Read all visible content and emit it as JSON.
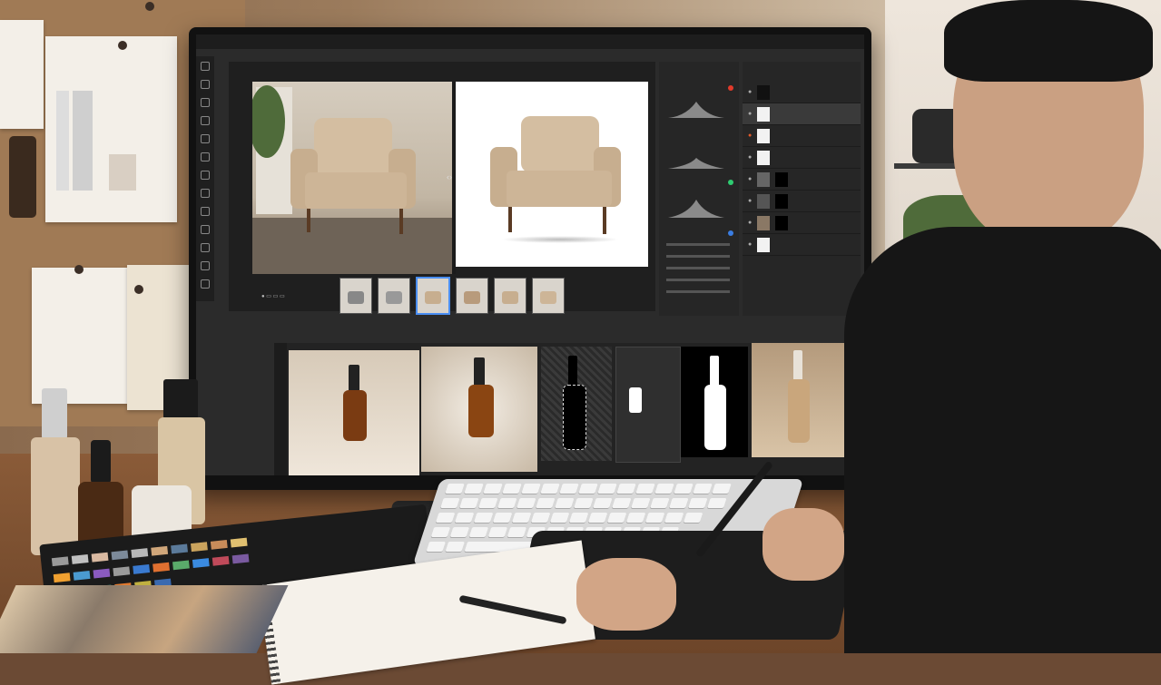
{
  "scene": {
    "description_colors": {
      "wall": "#9b7b5c",
      "desk": "#7a4f31",
      "screen_bg": "#2b2b2b",
      "accent_blue": "#4a8ef3"
    }
  },
  "app": {
    "menu": [
      "",
      "",
      "",
      "",
      "",
      "",
      "",
      "",
      "",
      ""
    ],
    "tabs": [
      "",
      ""
    ],
    "thumbnails_count": 6,
    "selected_thumbnail_index": 2,
    "adjustments_panel": {
      "title": "",
      "rows": [
        "",
        "",
        "",
        "",
        "",
        ""
      ]
    },
    "layers_panel": {
      "title": "",
      "layers": [
        "",
        "",
        "",
        "",
        "",
        "",
        "",
        "",
        ""
      ]
    },
    "bottom_panel": {
      "title": "",
      "items": [
        "",
        "",
        "",
        "",
        ""
      ]
    }
  },
  "icons": {
    "tools": [
      "move-icon",
      "marquee-icon",
      "lasso-icon",
      "crop-icon",
      "eyedropper-icon",
      "brush-icon",
      "stamp-icon",
      "eraser-icon",
      "gradient-icon",
      "pen-icon",
      "text-icon",
      "hand-icon",
      "zoom-icon"
    ],
    "split_handle": "split-arrows-icon",
    "eye": "eye-icon"
  }
}
